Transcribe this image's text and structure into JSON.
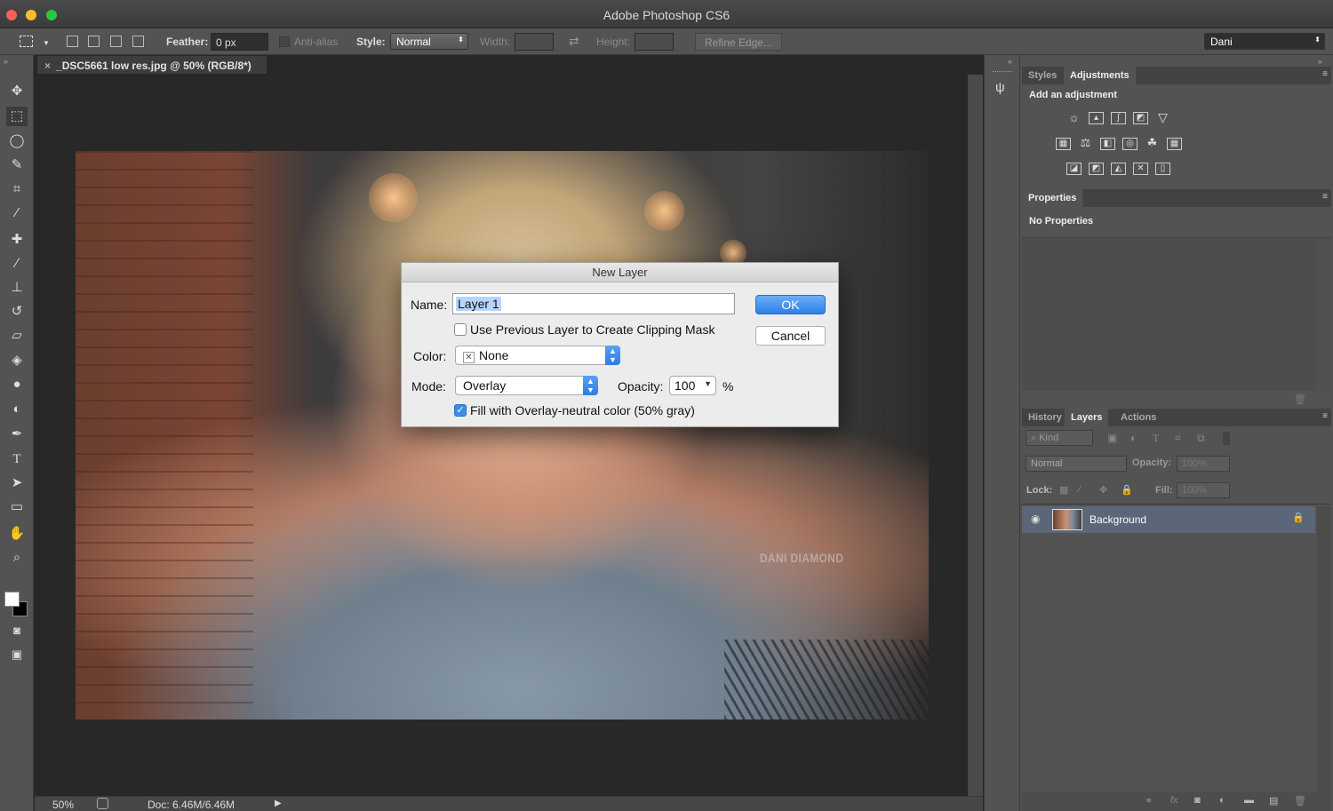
{
  "window": {
    "title": "Adobe Photoshop CS6",
    "controls": [
      "close",
      "minimize",
      "zoom"
    ],
    "colors": {
      "close": "#fc5f57",
      "minimize": "#fdbc2e",
      "zoom": "#28c840"
    }
  },
  "options_bar": {
    "feather_label": "Feather:",
    "feather_value": "0 px",
    "anti_alias_label": "Anti-alias",
    "style_label": "Style:",
    "style_value": "Normal",
    "width_label": "Width:",
    "height_label": "Height:",
    "refine_edge_label": "Refine Edge...",
    "workspace_value": "Dani"
  },
  "tools": [
    "move-tool-icon",
    "marquee-tool-icon",
    "lasso-tool-icon",
    "quick-select-tool-icon",
    "crop-tool-icon",
    "eyedropper-tool-icon",
    "healing-brush-icon",
    "brush-tool-icon",
    "clone-stamp-icon",
    "history-brush-icon",
    "eraser-tool-icon",
    "paint-bucket-icon",
    "blur-tool-icon",
    "dodge-tool-icon",
    "pen-tool-icon",
    "type-tool-icon",
    "path-select-icon",
    "rectangle-tool-icon",
    "hand-tool-icon",
    "zoom-tool-icon"
  ],
  "document": {
    "tab_title": "_DSC5661 low res.jpg @ 50% (RGB/8*)",
    "watermark": "DANI DIAMOND"
  },
  "dialog": {
    "title": "New Layer",
    "name_label": "Name:",
    "name_value": "Layer 1",
    "clipping_mask_label": "Use Previous Layer to Create Clipping Mask",
    "clipping_mask_checked": false,
    "color_label": "Color:",
    "color_value": "None",
    "mode_label": "Mode:",
    "mode_value": "Overlay",
    "opacity_label": "Opacity:",
    "opacity_value": "100",
    "opacity_unit": "%",
    "fill_label": "Fill with Overlay-neutral color (50% gray)",
    "fill_checked": true,
    "ok_label": "OK",
    "cancel_label": "Cancel",
    "accent": "#3b8ee8"
  },
  "panels": {
    "top_tabs": [
      "Styles",
      "Adjustments"
    ],
    "adjustments_heading": "Add an adjustment",
    "properties_tab": "Properties",
    "properties_text": "No Properties",
    "bottom_tabs": [
      "History",
      "Layers",
      "Actions"
    ],
    "kind_label": "Kind",
    "blend_mode": "Normal",
    "opacity_label": "Opacity:",
    "opacity_value": "100%",
    "lock_label": "Lock:",
    "fill_label": "Fill:",
    "fill_value": "100%",
    "layers": [
      {
        "name": "Background",
        "visible": true,
        "locked": true
      }
    ]
  },
  "status": {
    "zoom": "50%",
    "doc_size": "Doc: 6.46M/6.46M"
  }
}
